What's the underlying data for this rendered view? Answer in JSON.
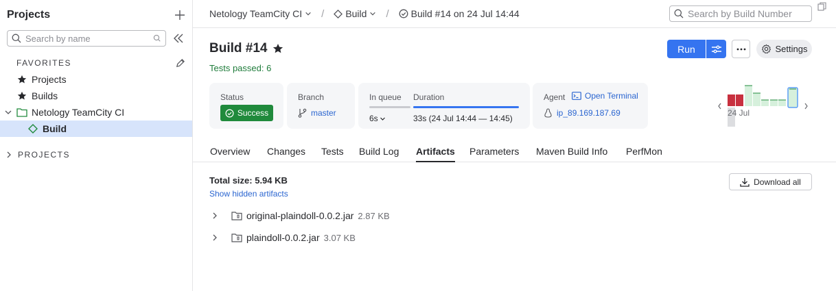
{
  "sidebar": {
    "title": "Projects",
    "search_placeholder": "Search by name",
    "favorites_heading": "FAVORITES",
    "favorites": [
      {
        "label": "Projects",
        "icon": "star-icon"
      },
      {
        "label": "Builds",
        "icon": "star-icon"
      }
    ],
    "project": {
      "label": "Netology TeamCity CI",
      "icon": "folder-icon"
    },
    "build_config": {
      "label": "Build",
      "icon": "build-diamond-icon"
    },
    "projects_heading": "PROJECTS"
  },
  "breadcrumb": {
    "project": "Netology TeamCity CI",
    "config": "Build",
    "build": "Build #14 on 24 Jul 14:44"
  },
  "top_search_placeholder": "Search by Build Number",
  "build": {
    "title": "Build #14",
    "tests": "Tests passed: 6",
    "run_label": "Run",
    "settings_label": "Settings"
  },
  "info": {
    "status_label": "Status",
    "status_value": "Success",
    "branch_label": "Branch",
    "branch_value": "master",
    "queue_label": "In queue",
    "queue_value": "6s",
    "duration_label": "Duration",
    "duration_value": "33s (24 Jul 14:44 — 14:45)",
    "agent_label": "Agent",
    "terminal_label": "Open Terminal",
    "agent_value": "ip_89.169.187.69"
  },
  "history": {
    "date_label": "24 Jul",
    "colors": {
      "failed": "#c8303f",
      "success": "#d6f0dc",
      "current_border": "#5b9df5"
    }
  },
  "tabs": [
    "Overview",
    "Changes",
    "Tests",
    "Build Log",
    "Artifacts",
    "Parameters",
    "Maven Build Info",
    "PerfMon"
  ],
  "active_tab": "Artifacts",
  "artifacts": {
    "total_size": "Total size: 5.94 KB",
    "show_hidden": "Show hidden artifacts",
    "download_all": "Download all",
    "items": [
      {
        "name": "original-plaindoll-0.0.2.jar",
        "size": "2.87 KB"
      },
      {
        "name": "plaindoll-0.0.2.jar",
        "size": "3.07 KB"
      }
    ]
  }
}
